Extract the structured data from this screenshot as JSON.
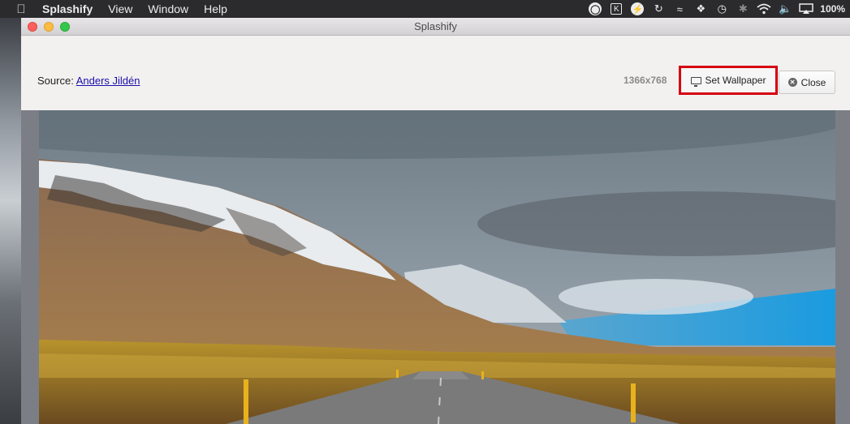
{
  "menubar": {
    "app_name": "Splashify",
    "items": [
      "View",
      "Window",
      "Help"
    ],
    "battery": "100%"
  },
  "window": {
    "title": "Splashify"
  },
  "toolbar": {
    "source_label": "Source:",
    "source_author": "Anders Jildén",
    "resolution": "1366x768",
    "set_wallpaper_label": "Set Wallpaper",
    "close_label": "Close"
  },
  "photo": {
    "description_icon": "landscape-photo"
  }
}
